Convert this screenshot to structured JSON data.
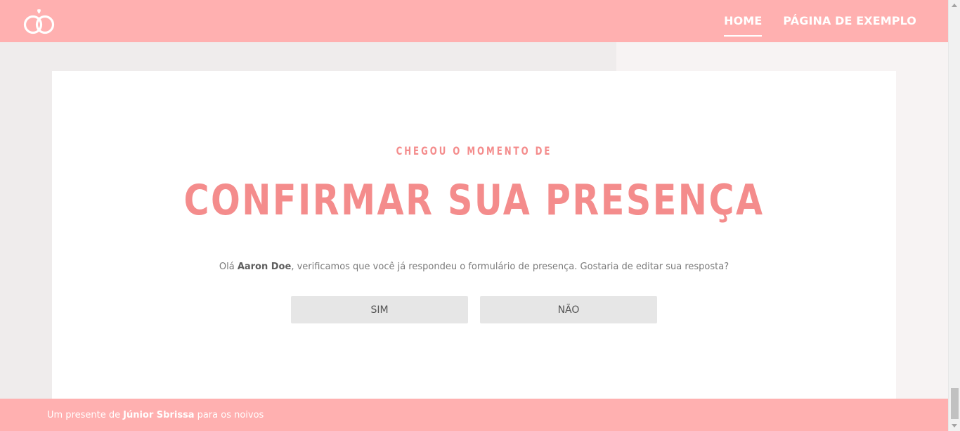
{
  "header": {
    "logo": "wedding-rings-icon",
    "nav": [
      {
        "label": "HOME",
        "active": true
      },
      {
        "label": "PÁGINA DE EXEMPLO",
        "active": false
      }
    ]
  },
  "rsvp": {
    "kicker": "CHEGOU O MOMENTO DE",
    "headline": "CONFIRMAR SUA PRESENÇA",
    "message_prefix": "Olá",
    "guest_name": "Aaron Doe",
    "message_suffix": ", verificamos que você já respondeu o formulário de presença. Gostaria de editar sua resposta?",
    "yes_label": "SIM",
    "no_label": "NÃO"
  },
  "footer": {
    "prefix": "Um presente de",
    "author": "Júnior Sbrissa",
    "suffix": "para os noivos"
  },
  "colors": {
    "brand": "#ffb0b0",
    "accent_text": "#f48c8c",
    "button_bg": "#e6e6e6"
  }
}
